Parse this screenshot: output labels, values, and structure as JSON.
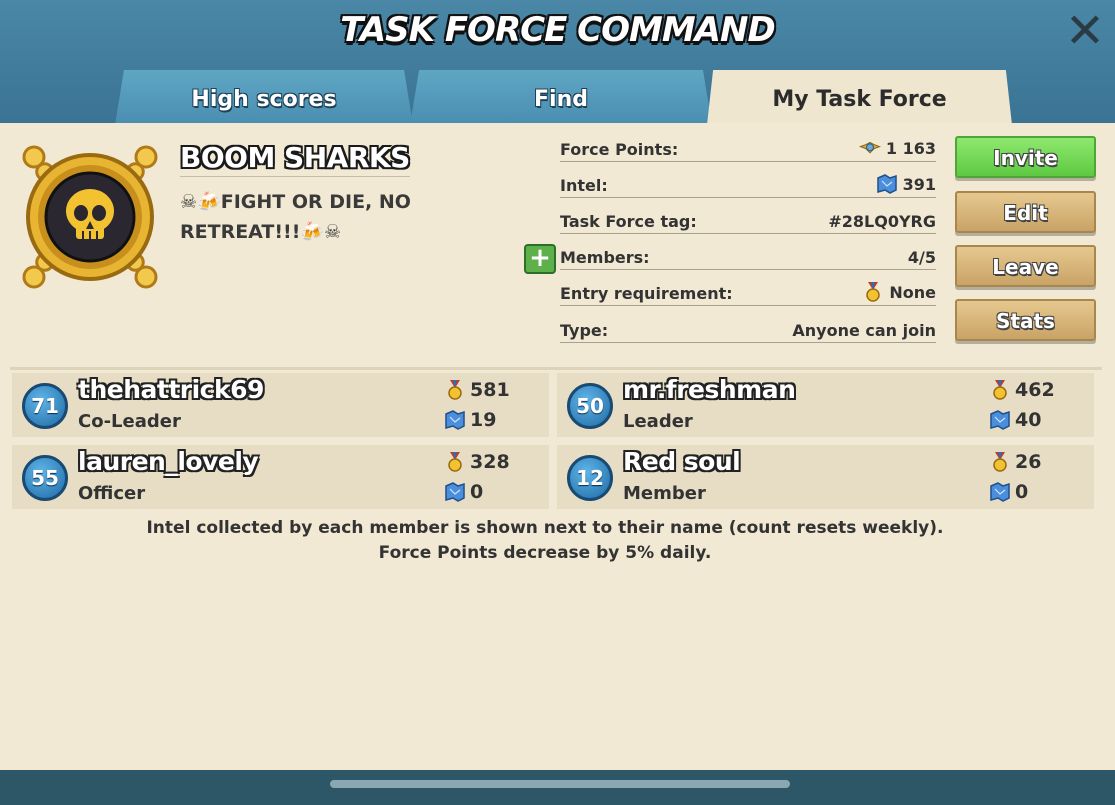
{
  "header": {
    "title": "TASK FORCE COMMAND",
    "close_icon": "close-icon"
  },
  "tabs": [
    {
      "label": "High scores",
      "active": false
    },
    {
      "label": "Find",
      "active": false
    },
    {
      "label": "My Task Force",
      "active": true
    }
  ],
  "task_force": {
    "emblem_icon": "skull-crossbones-emblem",
    "name": "BOOM SHARKS",
    "motto_line1": "FIGHT OR DIE, NO",
    "motto_line2": "RETREAT!!!"
  },
  "info": {
    "force_points_label": "Force Points:",
    "force_points_value": "1 163",
    "intel_label": "Intel:",
    "intel_value": "391",
    "tag_label": "Task Force tag:",
    "tag_value": "#28LQ0YRG",
    "members_label": "Members:",
    "members_value": "4/5",
    "entry_label": "Entry requirement:",
    "entry_value": "None",
    "type_label": "Type:",
    "type_value": "Anyone can join"
  },
  "actions": {
    "invite": "Invite",
    "edit": "Edit",
    "leave": "Leave",
    "stats": "Stats"
  },
  "members": [
    {
      "level": "71",
      "name": "thehattrick69",
      "role": "Co-Leader",
      "medals": "581",
      "intel": "19"
    },
    {
      "level": "50",
      "name": "mr.freshman",
      "role": "Leader",
      "medals": "462",
      "intel": "40"
    },
    {
      "level": "55",
      "name": "lauren_lovely",
      "role": "Officer",
      "medals": "328",
      "intel": "0"
    },
    {
      "level": "12",
      "name": "Red soul",
      "role": "Member",
      "medals": "26",
      "intel": "0"
    }
  ],
  "footer": {
    "line1": "Intel collected by each member is shown next to their name (count resets weekly).",
    "line2": "Force Points decrease by 5% daily."
  },
  "colors": {
    "panel": "#f1e9d4",
    "accent_green": "#5ec942",
    "tab_blue": "#4a8db0",
    "level_blue": "#1f6aa5"
  }
}
